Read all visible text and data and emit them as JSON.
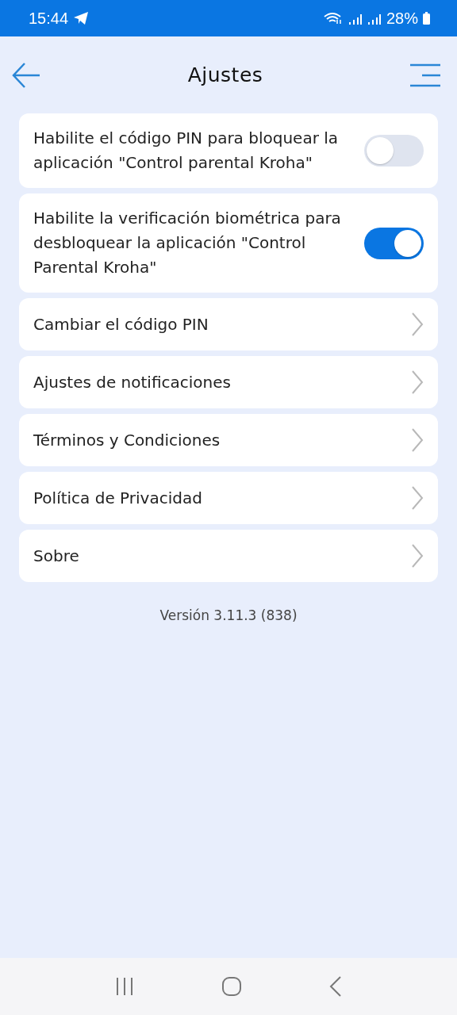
{
  "status_bar": {
    "time": "15:44",
    "battery": "28%"
  },
  "header": {
    "title": "Ajustes"
  },
  "items": [
    {
      "kind": "toggle",
      "label": "Habilite el código PIN para bloquear la aplicación \"Control parental Kroha\"",
      "on": false
    },
    {
      "kind": "toggle",
      "label": "Habilite la verificación biométrica para desbloquear la aplicación \"Control Parental Kroha\"",
      "on": true
    },
    {
      "kind": "link",
      "label": "Cambiar el código PIN"
    },
    {
      "kind": "link",
      "label": "Ajustes de notificaciones"
    },
    {
      "kind": "link",
      "label": "Términos y Condiciones"
    },
    {
      "kind": "link",
      "label": "Política de Privacidad"
    },
    {
      "kind": "link",
      "label": "Sobre"
    }
  ],
  "version": "Versión 3.11.3 (838)"
}
